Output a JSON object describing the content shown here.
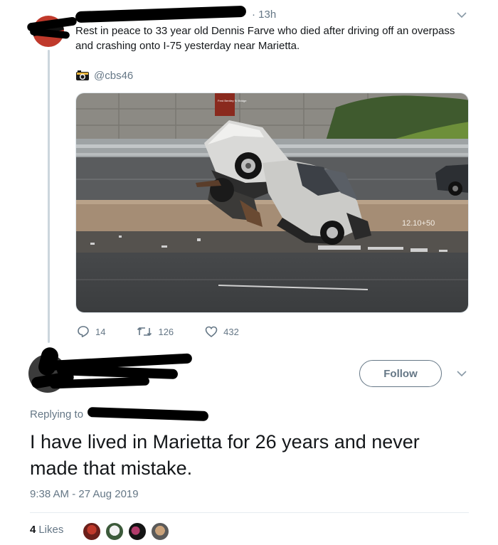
{
  "parent_tweet": {
    "time": "· 13h",
    "text": "Rest in peace to 33 year old Dennis Farve who died after driving off an overpass and crashing onto I-75 yesterday near Marietta.",
    "source_handle": "@cbs46",
    "media_sign": "12.10+50",
    "media_plaque": "Fred Bentley Sr Bridge",
    "replies": "14",
    "retweets": "126",
    "likes": "432"
  },
  "reply_tweet": {
    "follow_label": "Follow",
    "replying_to": "Replying to",
    "text": "I have lived in Marietta for 26 years and never made that mistake.",
    "timestamp": "9:38 AM - 27 Aug 2019",
    "likes_count": "4",
    "likes_label": "Likes"
  },
  "colors": {
    "secondary_text": "#657786",
    "follow_border": "#657786",
    "divider": "#e6ecf0"
  }
}
